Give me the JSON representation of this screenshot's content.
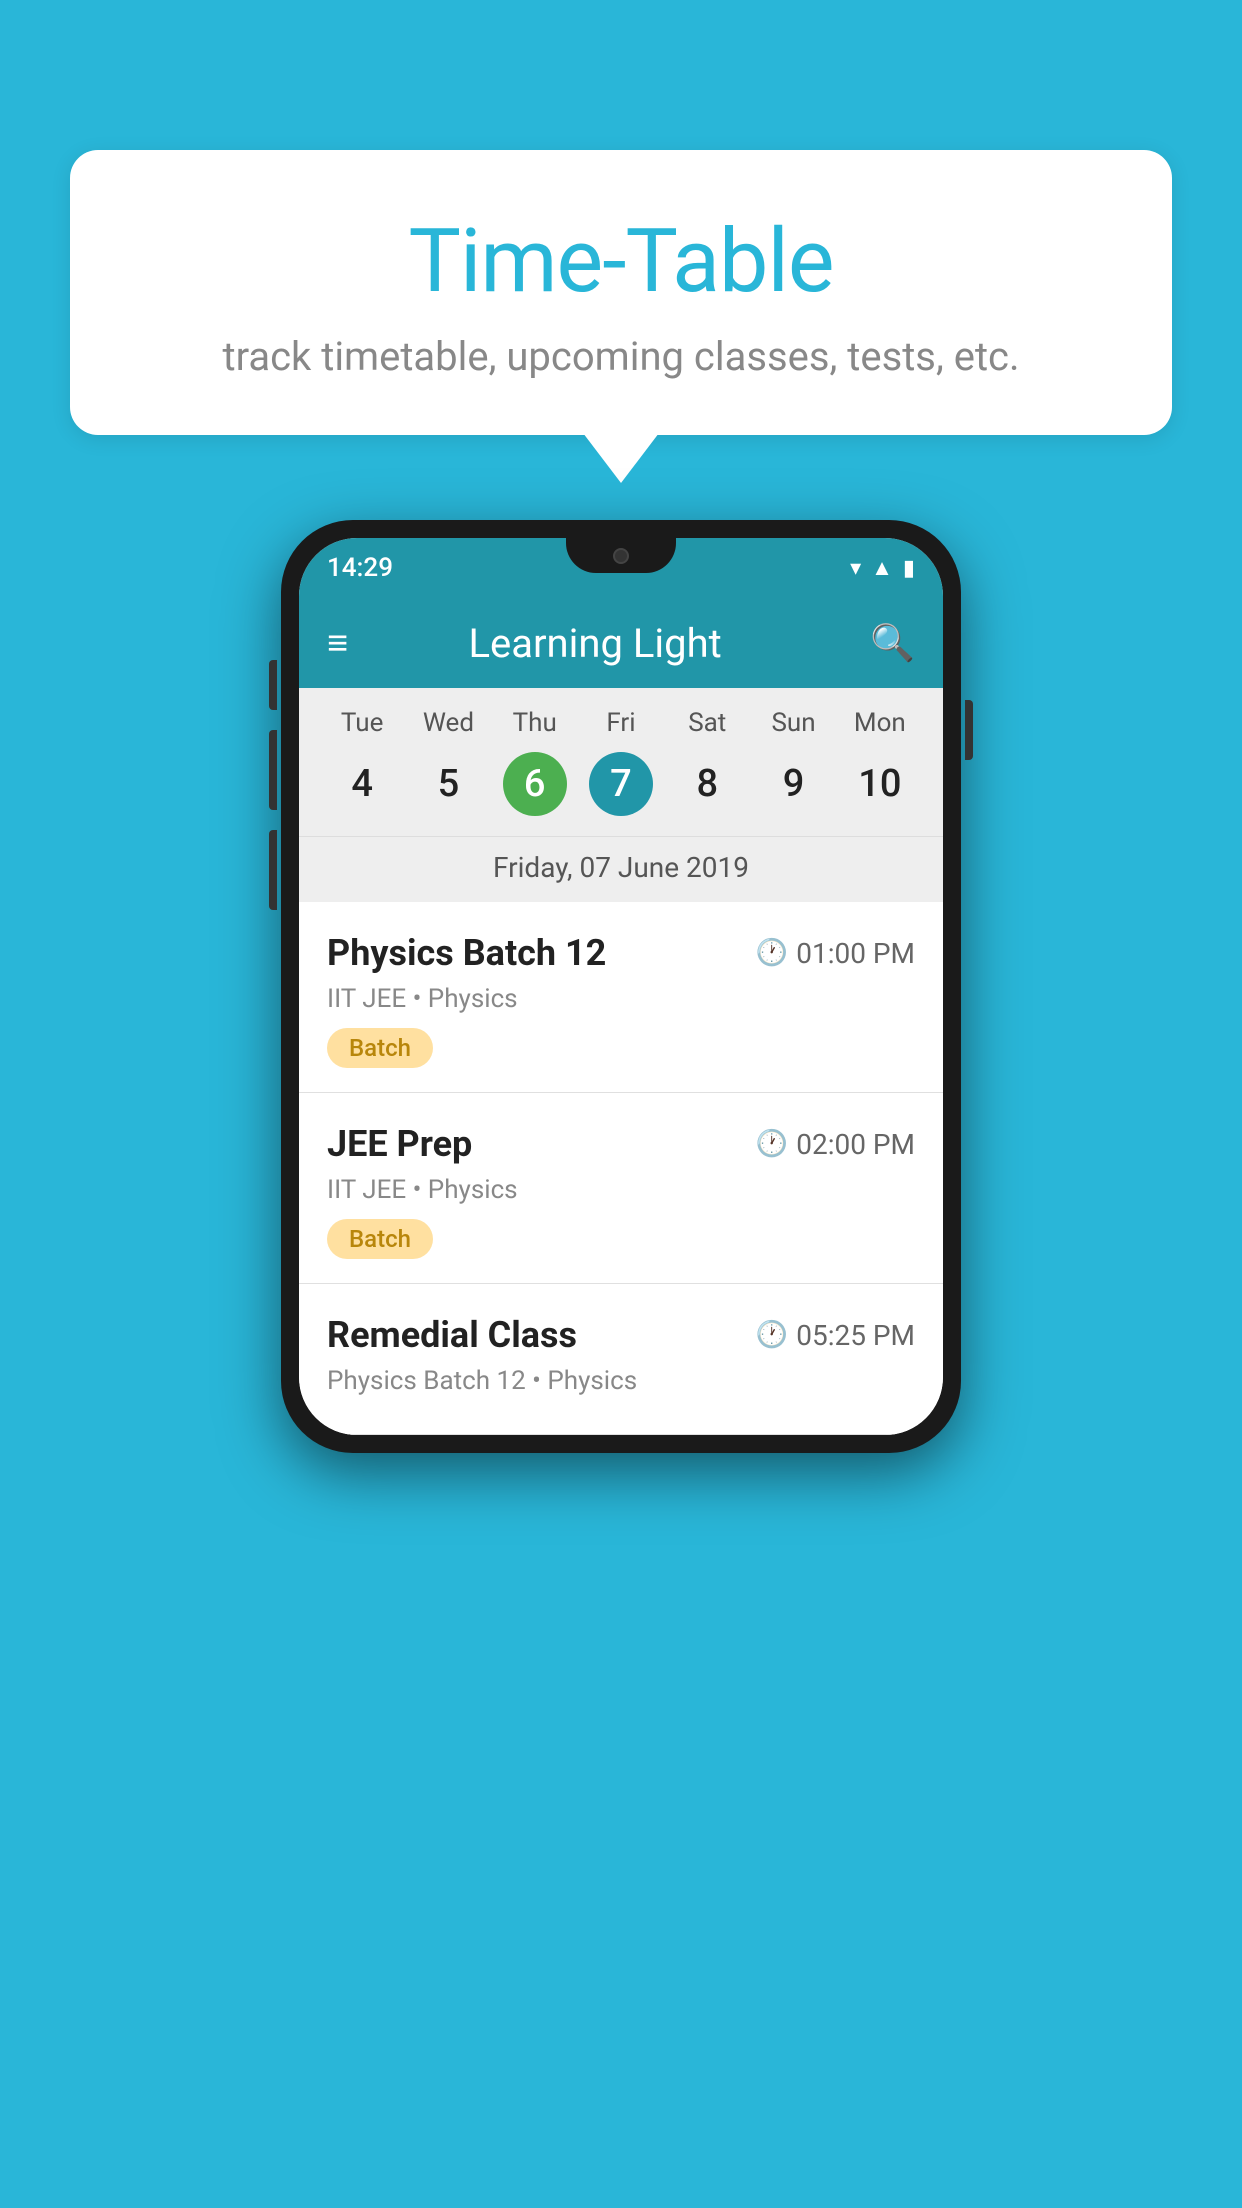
{
  "background_color": "#29b6d8",
  "speech_bubble": {
    "title": "Time-Table",
    "subtitle": "track timetable, upcoming classes, tests, etc."
  },
  "phone": {
    "status_bar": {
      "time": "14:29"
    },
    "app_bar": {
      "title": "Learning Light"
    },
    "calendar": {
      "days": [
        {
          "name": "Tue",
          "number": "4",
          "state": "normal"
        },
        {
          "name": "Wed",
          "number": "5",
          "state": "normal"
        },
        {
          "name": "Thu",
          "number": "6",
          "state": "today"
        },
        {
          "name": "Fri",
          "number": "7",
          "state": "selected"
        },
        {
          "name": "Sat",
          "number": "8",
          "state": "normal"
        },
        {
          "name": "Sun",
          "number": "9",
          "state": "normal"
        },
        {
          "name": "Mon",
          "number": "10",
          "state": "normal"
        }
      ],
      "selected_date_label": "Friday, 07 June 2019"
    },
    "schedule": [
      {
        "title": "Physics Batch 12",
        "time": "01:00 PM",
        "subtitle": "IIT JEE • Physics",
        "badge": "Batch"
      },
      {
        "title": "JEE Prep",
        "time": "02:00 PM",
        "subtitle": "IIT JEE • Physics",
        "badge": "Batch"
      },
      {
        "title": "Remedial Class",
        "time": "05:25 PM",
        "subtitle": "Physics Batch 12 • Physics",
        "badge": null
      }
    ]
  }
}
